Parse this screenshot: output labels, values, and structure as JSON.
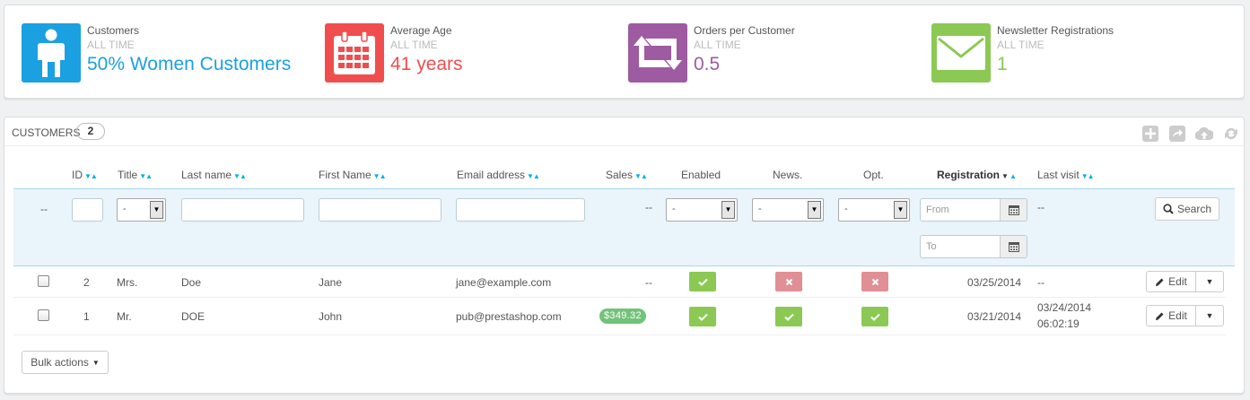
{
  "kpis": [
    {
      "title": "Customers",
      "subtitle": "ALL TIME",
      "value": "50% Women Customers",
      "color": "#1ba0e1",
      "icon": "user-icon"
    },
    {
      "title": "Average Age",
      "subtitle": "ALL TIME",
      "value": "41 years",
      "color": "#f04e4e",
      "icon": "calendar-icon"
    },
    {
      "title": "Orders per Customer",
      "subtitle": "ALL TIME",
      "value": "0.5",
      "color": "#9e5ba1",
      "icon": "retweet-icon"
    },
    {
      "title": "Newsletter Registrations",
      "subtitle": "ALL TIME",
      "value": "1",
      "color": "#8bc954",
      "icon": "envelope-icon"
    }
  ],
  "panel": {
    "title": "CUSTOMERS",
    "count": "2"
  },
  "columns": {
    "id": "ID",
    "title": "Title",
    "last_name": "Last name",
    "first_name": "First Name",
    "email": "Email address",
    "sales": "Sales",
    "enabled": "Enabled",
    "news": "News.",
    "opt": "Opt.",
    "registration": "Registration",
    "last_visit": "Last visit"
  },
  "filters": {
    "dash": "--",
    "title_select": "-",
    "sales": "--",
    "enabled_select": "-",
    "news_select": "-",
    "opt_select": "-",
    "from_placeholder": "From",
    "to_placeholder": "To",
    "last_visit": "--",
    "search_label": "Search"
  },
  "rows": [
    {
      "id": "2",
      "title": "Mrs.",
      "last_name": "Doe",
      "first_name": "Jane",
      "email": "jane@example.com",
      "sales": "--",
      "enabled": true,
      "news": false,
      "opt": false,
      "registration": "03/25/2014",
      "last_visit": "--",
      "last_visit_time": ""
    },
    {
      "id": "1",
      "title": "Mr.",
      "last_name": "DOE",
      "first_name": "John",
      "email": "pub@prestashop.com",
      "sales": "$349.32",
      "enabled": true,
      "news": true,
      "opt": true,
      "registration": "03/21/2014",
      "last_visit": "03/24/2014",
      "last_visit_time": "06:02:19"
    }
  ],
  "actions": {
    "edit_label": "Edit",
    "bulk_label": "Bulk actions"
  }
}
